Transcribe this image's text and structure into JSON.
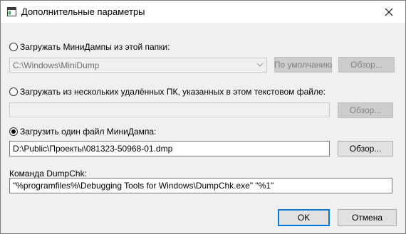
{
  "window": {
    "title": "Дополнительные параметры",
    "app_icon": "window-icon",
    "close_icon": "close-icon"
  },
  "options": {
    "folder": {
      "label": "Загружать МиниДампы из этой папки:",
      "selected": false,
      "path_value": "C:\\Windows\\MiniDump",
      "default_button": "По умолчанию",
      "browse_button": "Обзор..."
    },
    "remote": {
      "label": "Загружать из нескольких удалённых ПК, указанных в этом текстовом файле:",
      "selected": false,
      "file_value": "",
      "browse_button": "Обзор..."
    },
    "single": {
      "label": "Загрузить один файл МиниДампа:",
      "selected": true,
      "file_value": "D:\\Public\\Проекты\\081323-50968-01.dmp",
      "browse_button": "Обзор..."
    }
  },
  "dumpchk": {
    "label": "Команда DumpChk:",
    "value": "\"%programfiles%\\Debugging Tools for Windows\\DumpChk.exe\" \"%1\""
  },
  "footer": {
    "ok_label": "OK",
    "cancel_label": "Отмена"
  }
}
